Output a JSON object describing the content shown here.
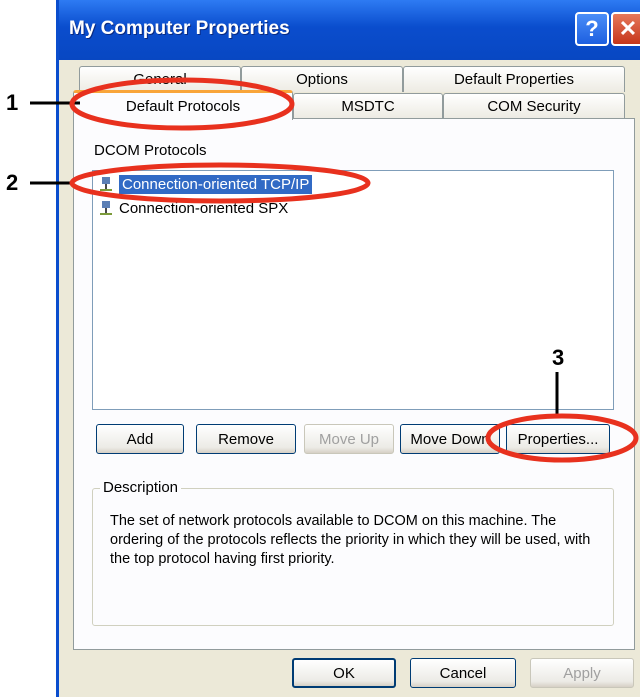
{
  "window": {
    "title": "My Computer Properties"
  },
  "tabs_back": [
    "General",
    "Options",
    "Default Properties"
  ],
  "tabs_front": [
    "Default Protocols",
    "MSDTC",
    "COM Security"
  ],
  "dcom": {
    "label": "DCOM Protocols",
    "items": [
      "Connection-oriented TCP/IP",
      "Connection-oriented SPX"
    ]
  },
  "buttons": {
    "add": "Add",
    "remove": "Remove",
    "move_up": "Move Up",
    "move_down": "Move Down",
    "properties": "Properties..."
  },
  "description": {
    "title": "Description",
    "text": "The set of network protocols available to DCOM on this machine. The ordering of the protocols reflects the priority in which they will be used, with the top protocol having first priority."
  },
  "footer": {
    "ok": "OK",
    "cancel": "Cancel",
    "apply": "Apply"
  },
  "annotations": [
    "1",
    "2",
    "3"
  ],
  "colors": {
    "title_bar": "#0A4DCD",
    "selection": "#316AC5",
    "annotation": "#E8311E",
    "active_tab": "#F9A53A"
  }
}
